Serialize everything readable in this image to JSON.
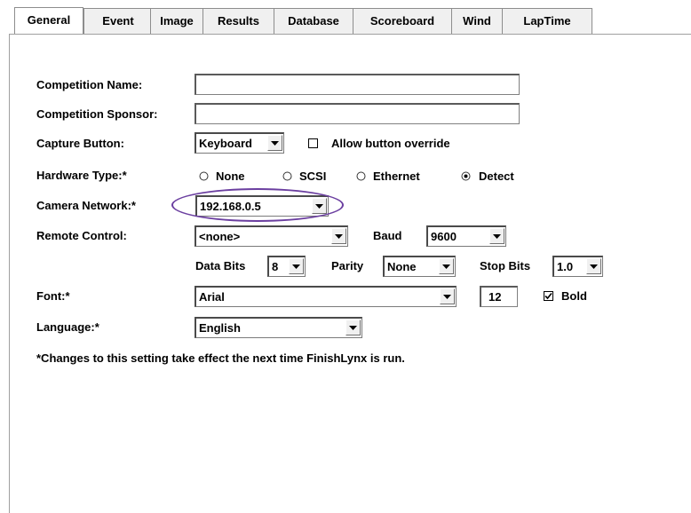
{
  "tabs": [
    "General",
    "Event",
    "Image",
    "Results",
    "Database",
    "Scoreboard",
    "Wind",
    "LapTime"
  ],
  "general": {
    "competition_name_label": "Competition Name:",
    "competition_name_value": "",
    "competition_sponsor_label": "Competition Sponsor:",
    "competition_sponsor_value": "",
    "capture_button_label": "Capture Button:",
    "capture_button_value": "Keyboard",
    "allow_override_label": "Allow button override",
    "allow_override_checked": false,
    "hardware_type_label": "Hardware Type:*",
    "hardware_options": [
      "None",
      "SCSI",
      "Ethernet",
      "Detect"
    ],
    "hardware_selected": "Detect",
    "camera_network_label": "Camera Network:*",
    "camera_network_value": "192.168.0.5",
    "remote_control_label": "Remote Control:",
    "remote_control_value": "<none>",
    "baud_label": "Baud",
    "baud_value": "9600",
    "data_bits_label": "Data Bits",
    "data_bits_value": "8",
    "parity_label": "Parity",
    "parity_value": "None",
    "stop_bits_label": "Stop Bits",
    "stop_bits_value": "1.0",
    "font_label": "Font:*",
    "font_value": "Arial",
    "font_size_value": "12",
    "bold_label": "Bold",
    "bold_checked": true,
    "language_label": "Language:*",
    "language_value": "English",
    "note": "*Changes to this setting take effect the next time FinishLynx is run."
  },
  "colors": {
    "highlight_ellipse": "#6b3fa0"
  }
}
